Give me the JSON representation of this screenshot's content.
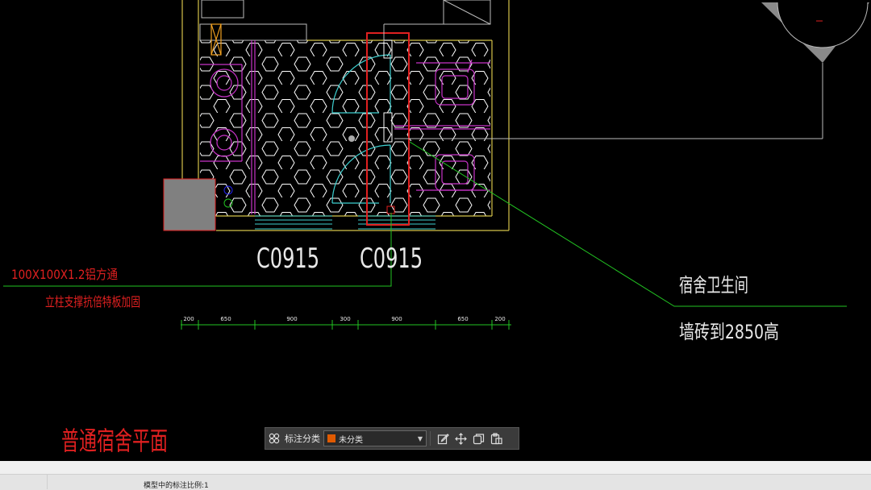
{
  "drawing": {
    "window_labels": [
      "C0915",
      "C0915"
    ],
    "note_left_line1": "100X100X1.2铝方通",
    "note_left_line2": "立柱支撑抗倍特板加固",
    "note_right_line1": "宿舍卫生间",
    "note_right_line2": "墙砖到2850高",
    "dimensions": [
      "200",
      "650",
      "900",
      "300",
      "900",
      "650",
      "200"
    ],
    "title": "普通宿舍平面",
    "colors": {
      "wall": "#d4c24a",
      "green": "#22c322",
      "magenta": "#c833c8",
      "cyan": "#3ed0d0",
      "red": "#e02020",
      "white": "#e8e8e8"
    }
  },
  "toolbar": {
    "classify_icon": "grid-icon",
    "label": "标注分类",
    "category_value": "未分类",
    "category_color": "#e05a00",
    "actions": [
      "edit-icon",
      "move-icon",
      "copy-icon",
      "paste-icon"
    ]
  },
  "statusbar": {
    "scale_text": "模型中的标注比例:1"
  }
}
